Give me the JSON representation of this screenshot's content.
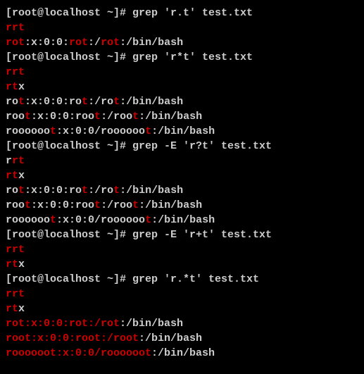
{
  "lines": [
    [
      [
        "w",
        "[root@localhost ~]# grep 'r.t' test.txt"
      ]
    ],
    [
      [
        "r",
        "rrt"
      ]
    ],
    [
      [
        "r",
        "rot"
      ],
      [
        "w",
        ":x:0:0:"
      ],
      [
        "r",
        "rot"
      ],
      [
        "w",
        ":/"
      ],
      [
        "r",
        "rot"
      ],
      [
        "w",
        ":/bin/bash"
      ]
    ],
    [
      [
        "w",
        "[root@localhost ~]# grep 'r*t' test.txt"
      ]
    ],
    [
      [
        "r",
        "rrt"
      ]
    ],
    [
      [
        "r",
        "rt"
      ],
      [
        "w",
        "x"
      ]
    ],
    [
      [
        "w",
        "ro"
      ],
      [
        "r",
        "t"
      ],
      [
        "w",
        ":x:0:0:ro"
      ],
      [
        "r",
        "t"
      ],
      [
        "w",
        ":/ro"
      ],
      [
        "r",
        "t"
      ],
      [
        "w",
        ":/bin/bash"
      ]
    ],
    [
      [
        "w",
        "roo"
      ],
      [
        "r",
        "t"
      ],
      [
        "w",
        ":x:0:0:roo"
      ],
      [
        "r",
        "t"
      ],
      [
        "w",
        ":/roo"
      ],
      [
        "r",
        "t"
      ],
      [
        "w",
        ":/bin/bash"
      ]
    ],
    [
      [
        "w",
        "roooooo"
      ],
      [
        "r",
        "t"
      ],
      [
        "w",
        ":x:0:0/roooooo"
      ],
      [
        "r",
        "t"
      ],
      [
        "w",
        ":/bin/bash"
      ]
    ],
    [
      [
        "w",
        "[root@localhost ~]# grep -E 'r?t' test.txt"
      ]
    ],
    [
      [
        "w",
        "r"
      ],
      [
        "r",
        "rt"
      ]
    ],
    [
      [
        "r",
        "rt"
      ],
      [
        "w",
        "x"
      ]
    ],
    [
      [
        "w",
        "ro"
      ],
      [
        "r",
        "t"
      ],
      [
        "w",
        ":x:0:0:ro"
      ],
      [
        "r",
        "t"
      ],
      [
        "w",
        ":/ro"
      ],
      [
        "r",
        "t"
      ],
      [
        "w",
        ":/bin/bash"
      ]
    ],
    [
      [
        "w",
        "roo"
      ],
      [
        "r",
        "t"
      ],
      [
        "w",
        ":x:0:0:roo"
      ],
      [
        "r",
        "t"
      ],
      [
        "w",
        ":/roo"
      ],
      [
        "r",
        "t"
      ],
      [
        "w",
        ":/bin/bash"
      ]
    ],
    [
      [
        "w",
        "roooooo"
      ],
      [
        "r",
        "t"
      ],
      [
        "w",
        ":x:0:0/roooooo"
      ],
      [
        "r",
        "t"
      ],
      [
        "w",
        ":/bin/bash"
      ]
    ],
    [
      [
        "w",
        "[root@localhost ~]# grep -E 'r+t' test.txt"
      ]
    ],
    [
      [
        "r",
        "rrt"
      ]
    ],
    [
      [
        "r",
        "rt"
      ],
      [
        "w",
        "x"
      ]
    ],
    [
      [
        "w",
        "[root@localhost ~]# grep 'r.*t' test.txt"
      ]
    ],
    [
      [
        "r",
        "rrt"
      ]
    ],
    [
      [
        "r",
        "rt"
      ],
      [
        "w",
        "x"
      ]
    ],
    [
      [
        "r",
        "rot:x:0:0:rot:/rot"
      ],
      [
        "w",
        ":/bin/bash"
      ]
    ],
    [
      [
        "r",
        "root:x:0:0:root:/root"
      ],
      [
        "w",
        ":/bin/bash"
      ]
    ],
    [
      [
        "r",
        "roooooot:x:0:0/roooooot"
      ],
      [
        "w",
        ":/bin/bash"
      ]
    ]
  ]
}
